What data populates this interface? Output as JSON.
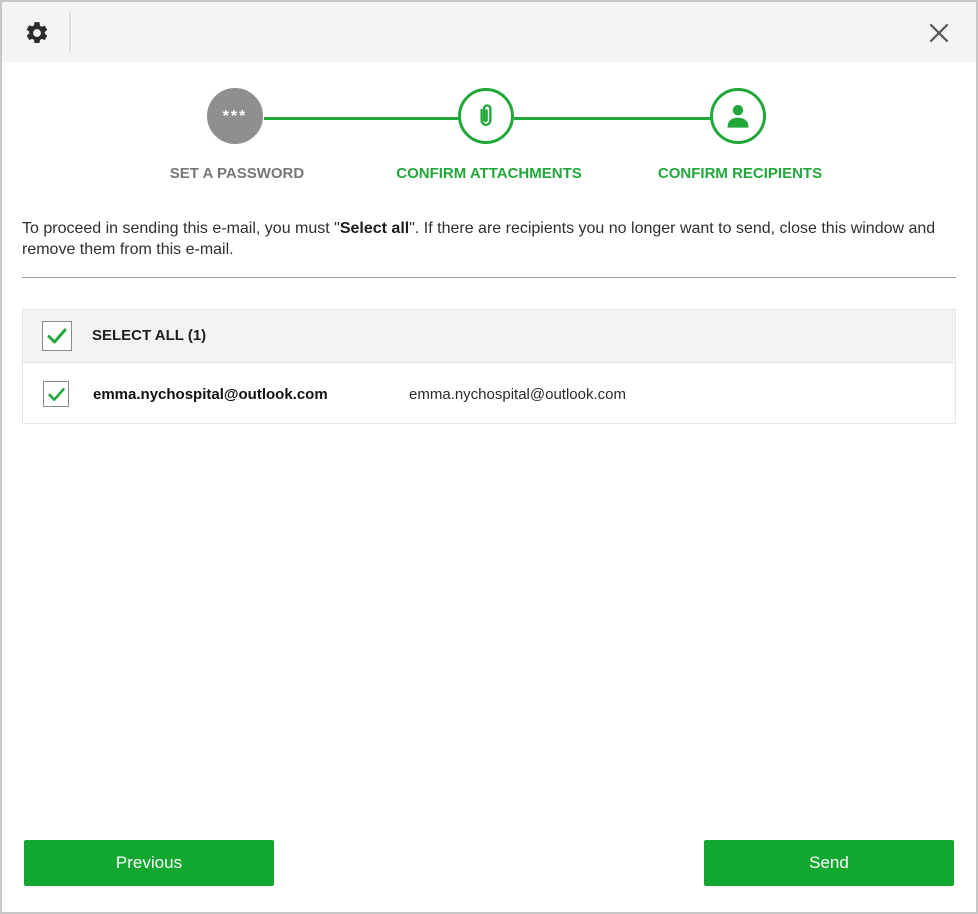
{
  "icons": {
    "settings": "gear-icon",
    "close": "close-icon",
    "step1": "password-dots-icon",
    "step2": "paperclip-icon",
    "step3": "person-icon",
    "check": "checkmark-icon"
  },
  "colors": {
    "accent": "#22a83a",
    "button": "#12a82f",
    "step_done": "#8f8f8f"
  },
  "stepper": {
    "steps": [
      {
        "label": "SET A PASSWORD",
        "glyph": "***",
        "state": "completed"
      },
      {
        "label": "CONFIRM ATTACHMENTS",
        "state": "active"
      },
      {
        "label": "CONFIRM RECIPIENTS",
        "state": "active"
      }
    ]
  },
  "instruction": {
    "before": "To proceed in sending this e-mail, you must \"",
    "bold": "Select all",
    "after": "\". If there are recipients you no longer want to send, close this window and remove them from this e-mail."
  },
  "recipients": {
    "select_all_label": "SELECT ALL (1)",
    "select_all_checked": true,
    "items": [
      {
        "name": "emma.nychospital@outlook.com",
        "email": "emma.nychospital@outlook.com",
        "checked": true
      }
    ]
  },
  "buttons": {
    "previous": "Previous",
    "send": "Send"
  }
}
